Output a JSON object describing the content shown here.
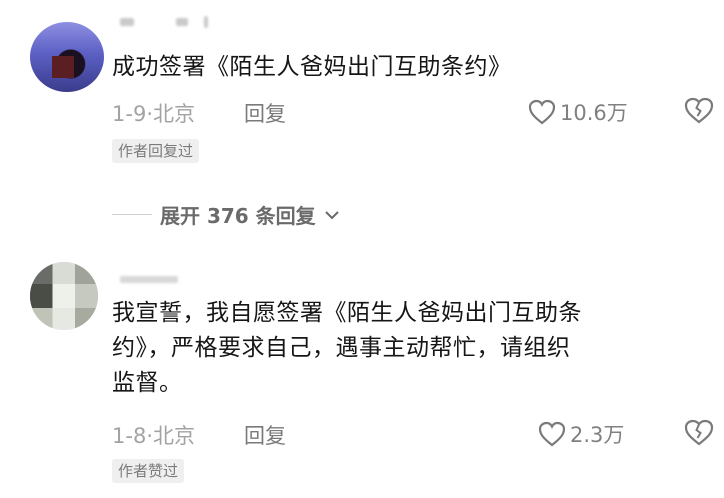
{
  "comments": [
    {
      "text": "成功签署《陌生人爸妈出门互助条约》",
      "date": "1-9",
      "location": "北京",
      "reply_label": "回复",
      "likes": "10.6万",
      "badge": "作者回复过"
    },
    {
      "text_line1": "我宣誓，我自愿签署《陌生人爸妈出门互助条",
      "text_line2": "约》，严格要求自己，遇事主动帮忙，请组织",
      "text_line3": "监督。",
      "date": "1-8",
      "location": "北京",
      "reply_label": "回复",
      "likes": "2.3万",
      "badge": "作者赞过"
    }
  ],
  "thread": {
    "expand_label": "展开 376 条回复"
  },
  "icons": {
    "like": "heart-outline-icon",
    "dislike": "broken-heart-icon",
    "expand": "chevron-down-icon"
  },
  "colors": {
    "text": "#161616",
    "meta": "#a3a3a3",
    "badge_bg": "#efefef"
  }
}
